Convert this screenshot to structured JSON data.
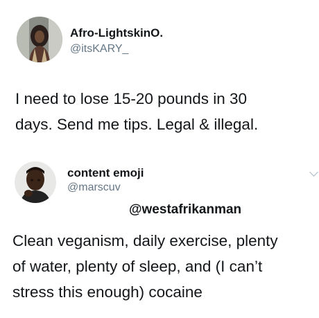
{
  "tweet1": {
    "display_name": "Afro-LightskinO.",
    "handle": "@itsKARY_",
    "text_line1": "I need to lose 15-20 pounds in 30",
    "text_line2": "days. Send me tips. Legal & illegal."
  },
  "tweet2": {
    "display_name": "content emoji",
    "handle": "@marscuv",
    "mention": "@westafrikanman",
    "text_line1": "Clean veganism, daily exercise, plenty",
    "text_line2": "of water, plenty of sleep, and (I can’t",
    "text_line3": "stress this enough) cocaine"
  },
  "icons": [
    "avatar-photo",
    "chevron-down-icon"
  ]
}
